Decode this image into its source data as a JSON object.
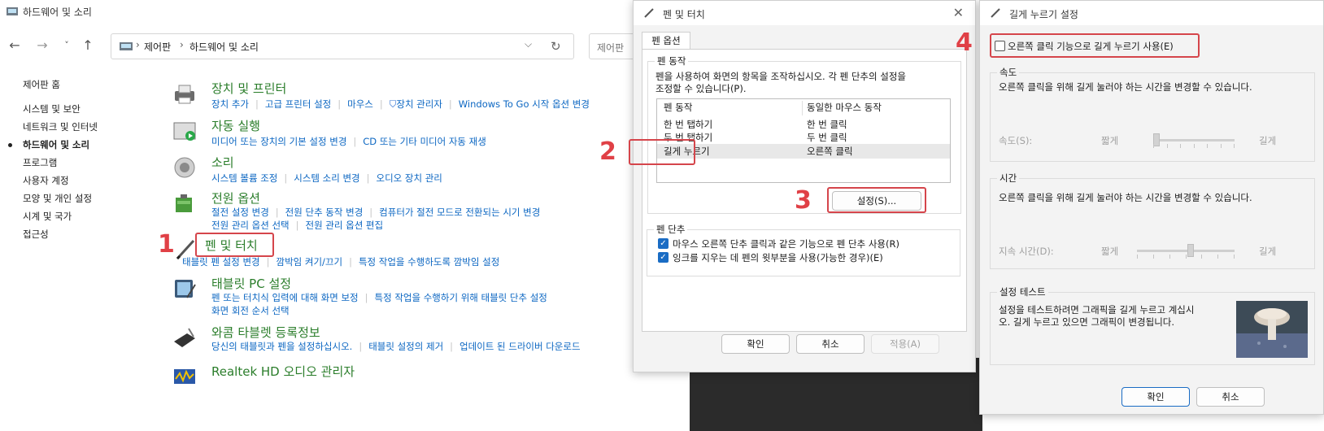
{
  "control_panel": {
    "window_title": "하드웨어 및 소리",
    "breadcrumb": [
      "제어판",
      "하드웨어 및 소리"
    ],
    "search_placeholder": "제어판",
    "left_nav": [
      {
        "label": "제어판 홈",
        "active": false
      },
      {
        "label": "시스템 및 보안",
        "active": false
      },
      {
        "label": "네트워크 및 인터넷",
        "active": false
      },
      {
        "label": "하드웨어 및 소리",
        "active": true
      },
      {
        "label": "프로그램",
        "active": false
      },
      {
        "label": "사용자 계정",
        "active": false
      },
      {
        "label": "모양 및 개인 설정",
        "active": false
      },
      {
        "label": "시계 및 국가",
        "active": false
      },
      {
        "label": "접근성",
        "active": false
      }
    ],
    "categories": {
      "devices": {
        "title": "장치 및 프린터",
        "links": [
          "장치 추가",
          "고급 프린터 설정",
          "마우스",
          "장치 관리자",
          "Windows To Go 시작 옵션 변경"
        ]
      },
      "autoplay": {
        "title": "자동 실행",
        "links": [
          "미디어 또는 장치의 기본 설정 변경",
          "CD 또는 기타 미디어 자동 재생"
        ]
      },
      "sound": {
        "title": "소리",
        "links": [
          "시스템 볼륨 조정",
          "시스템 소리 변경",
          "오디오 장치 관리"
        ]
      },
      "power": {
        "title": "전원 옵션",
        "links_row1": [
          "절전 설정 변경",
          "전원 단추 동작 변경",
          "컴퓨터가 절전 모드로 전환되는 시기 변경"
        ],
        "links_row2": [
          "전원 관리 옵션 선택",
          "전원 관리 옵션 편집"
        ]
      },
      "pen": {
        "title": "펜 및 터치",
        "links": [
          "태블릿 펜 설정 변경",
          "깜박임 켜기/끄기",
          "특정 작업을 수행하도록 깜박임 설정"
        ]
      },
      "tablet": {
        "title": "태블릿 PC 설정",
        "links_row1": [
          "펜 또는 터치식 입력에 대해 화면 보정",
          "특정 작업을 수행하기 위해 태블릿 단추 설정"
        ],
        "links_row2": [
          "화면 회전 순서 선택"
        ]
      },
      "wacom": {
        "title": "와콤 타블렛 등록정보",
        "links": [
          "당신의 태블릿과 펜을 설정하십시오.",
          "태블릿 설정의 제거",
          "업데이트 된 드라이버 다운로드"
        ]
      },
      "realtek": {
        "title": "Realtek HD 오디오 관리자"
      }
    }
  },
  "pen_dialog": {
    "title": "펜 및 터치",
    "tab": "펜 옵션",
    "group_pen_actions": "펜 동작",
    "description": [
      "펜을 사용하여 화면의 항목을 조작하십시오. 각 펜 단추의 설정을",
      "조정할 수 있습니다(P)."
    ],
    "col_action": "펜 동작",
    "col_mouse": "동일한 마우스 동작",
    "rows": [
      {
        "action": "한 번 탭하기",
        "mouse": "한 번 클릭"
      },
      {
        "action": "두 번 탭하기",
        "mouse": "두 번 클릭"
      },
      {
        "action": "길게 누르기",
        "mouse": "오른쪽 클릭"
      }
    ],
    "settings_button": "설정(S)...",
    "group_pen_buttons": "펜 단추",
    "checkbox1": "마우스 오른쪽 단추 클릭과 같은 기능으로 펜 단추 사용(R)",
    "checkbox2": "잉크를 지우는 데 펜의 윗부분을 사용(가능한 경우)(E)",
    "ok": "확인",
    "cancel": "취소",
    "apply": "적용(A)"
  },
  "hold_dialog": {
    "title": "길게 누르기 설정",
    "enable_checkbox": "오른쪽 클릭 기능으로 길게 누르기 사용(E)",
    "speed_group": "속도",
    "speed_desc": "오른쪽 클릭을 위해 길게 눌러야 하는 시간을 변경할 수 있습니다.",
    "speed_label": "속도(S):",
    "short": "짧게",
    "long": "길게",
    "speed_level": 0.0,
    "time_group": "시간",
    "time_desc": "오른쪽 클릭을 위해 길게 눌러야 하는 시간을 변경할 수 있습니다.",
    "duration_label": "지속 시간(D):",
    "duration_level": 0.55,
    "test_group": "설정 테스트",
    "test_desc": [
      "설정을 테스트하려면 그래픽을 길게 누르고 계십시",
      "오. 길게 누르고 있으면 그래픽이 변경됩니다."
    ],
    "ok": "확인",
    "cancel": "취소"
  },
  "markers": [
    "1",
    "2",
    "3",
    "4"
  ],
  "accent_colors": {
    "annotation": "#d5454b",
    "link": "#0b66c2",
    "category": "#2a7d2a",
    "primary_button": "#1a6cc4"
  }
}
